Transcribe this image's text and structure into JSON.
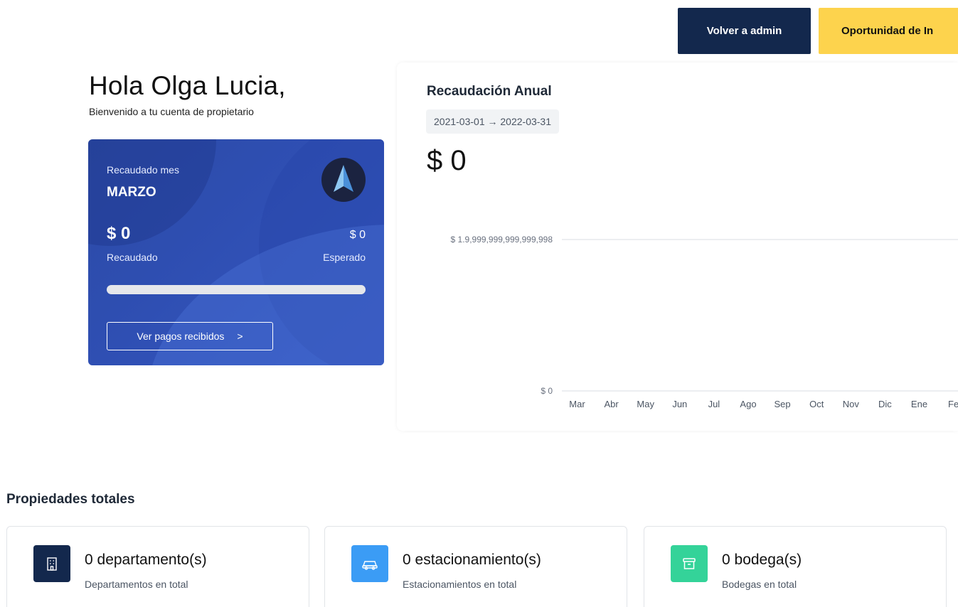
{
  "header": {
    "back_admin_label": "Volver a admin",
    "opportunity_label": "Oportunidad de In"
  },
  "greeting": {
    "title": "Hola Olga Lucia,",
    "subtitle": "Bienvenido a tu cuenta de propietario"
  },
  "month_card": {
    "label": "Recaudado mes",
    "month": "MARZO",
    "collected_amount": "$ 0",
    "collected_label": "Recaudado",
    "expected_amount": "$ 0",
    "expected_label": "Esperado",
    "progress": 0,
    "button_label": "Ver pagos recibidos",
    "button_arrow": ">"
  },
  "annual": {
    "title": "Recaudación Anual",
    "range": "2021-03-01 → 2022-03-31",
    "total": "$ 0"
  },
  "chart_data": {
    "type": "bar",
    "categories": [
      "Mar",
      "Abr",
      "May",
      "Jun",
      "Jul",
      "Ago",
      "Sep",
      "Oct",
      "Nov",
      "Dic",
      "Ene",
      "Fe"
    ],
    "values": [
      0,
      0,
      0,
      0,
      0,
      0,
      0,
      0,
      0,
      0,
      0,
      0
    ],
    "y_ticks": [
      "$ 1.9,999,999,999,999,998",
      "$ 0"
    ],
    "ylim": [
      0,
      2
    ],
    "grid": true
  },
  "properties": {
    "title": "Propiedades totales",
    "items": [
      {
        "title": "0 departamento(s)",
        "subtitle": "Departamentos en total",
        "icon": "building-icon",
        "color": "#13284d"
      },
      {
        "title": "0 estacionamiento(s)",
        "subtitle": "Estacionamientos en total",
        "icon": "car-icon",
        "color": "#3b9cf5"
      },
      {
        "title": "0 bodega(s)",
        "subtitle": "Bodegas en total",
        "icon": "archive-box-icon",
        "color": "#34d399"
      }
    ]
  },
  "colors": {
    "navy": "#13284d",
    "yellow": "#fdd34d",
    "card_blue": "#2f4fb3"
  }
}
